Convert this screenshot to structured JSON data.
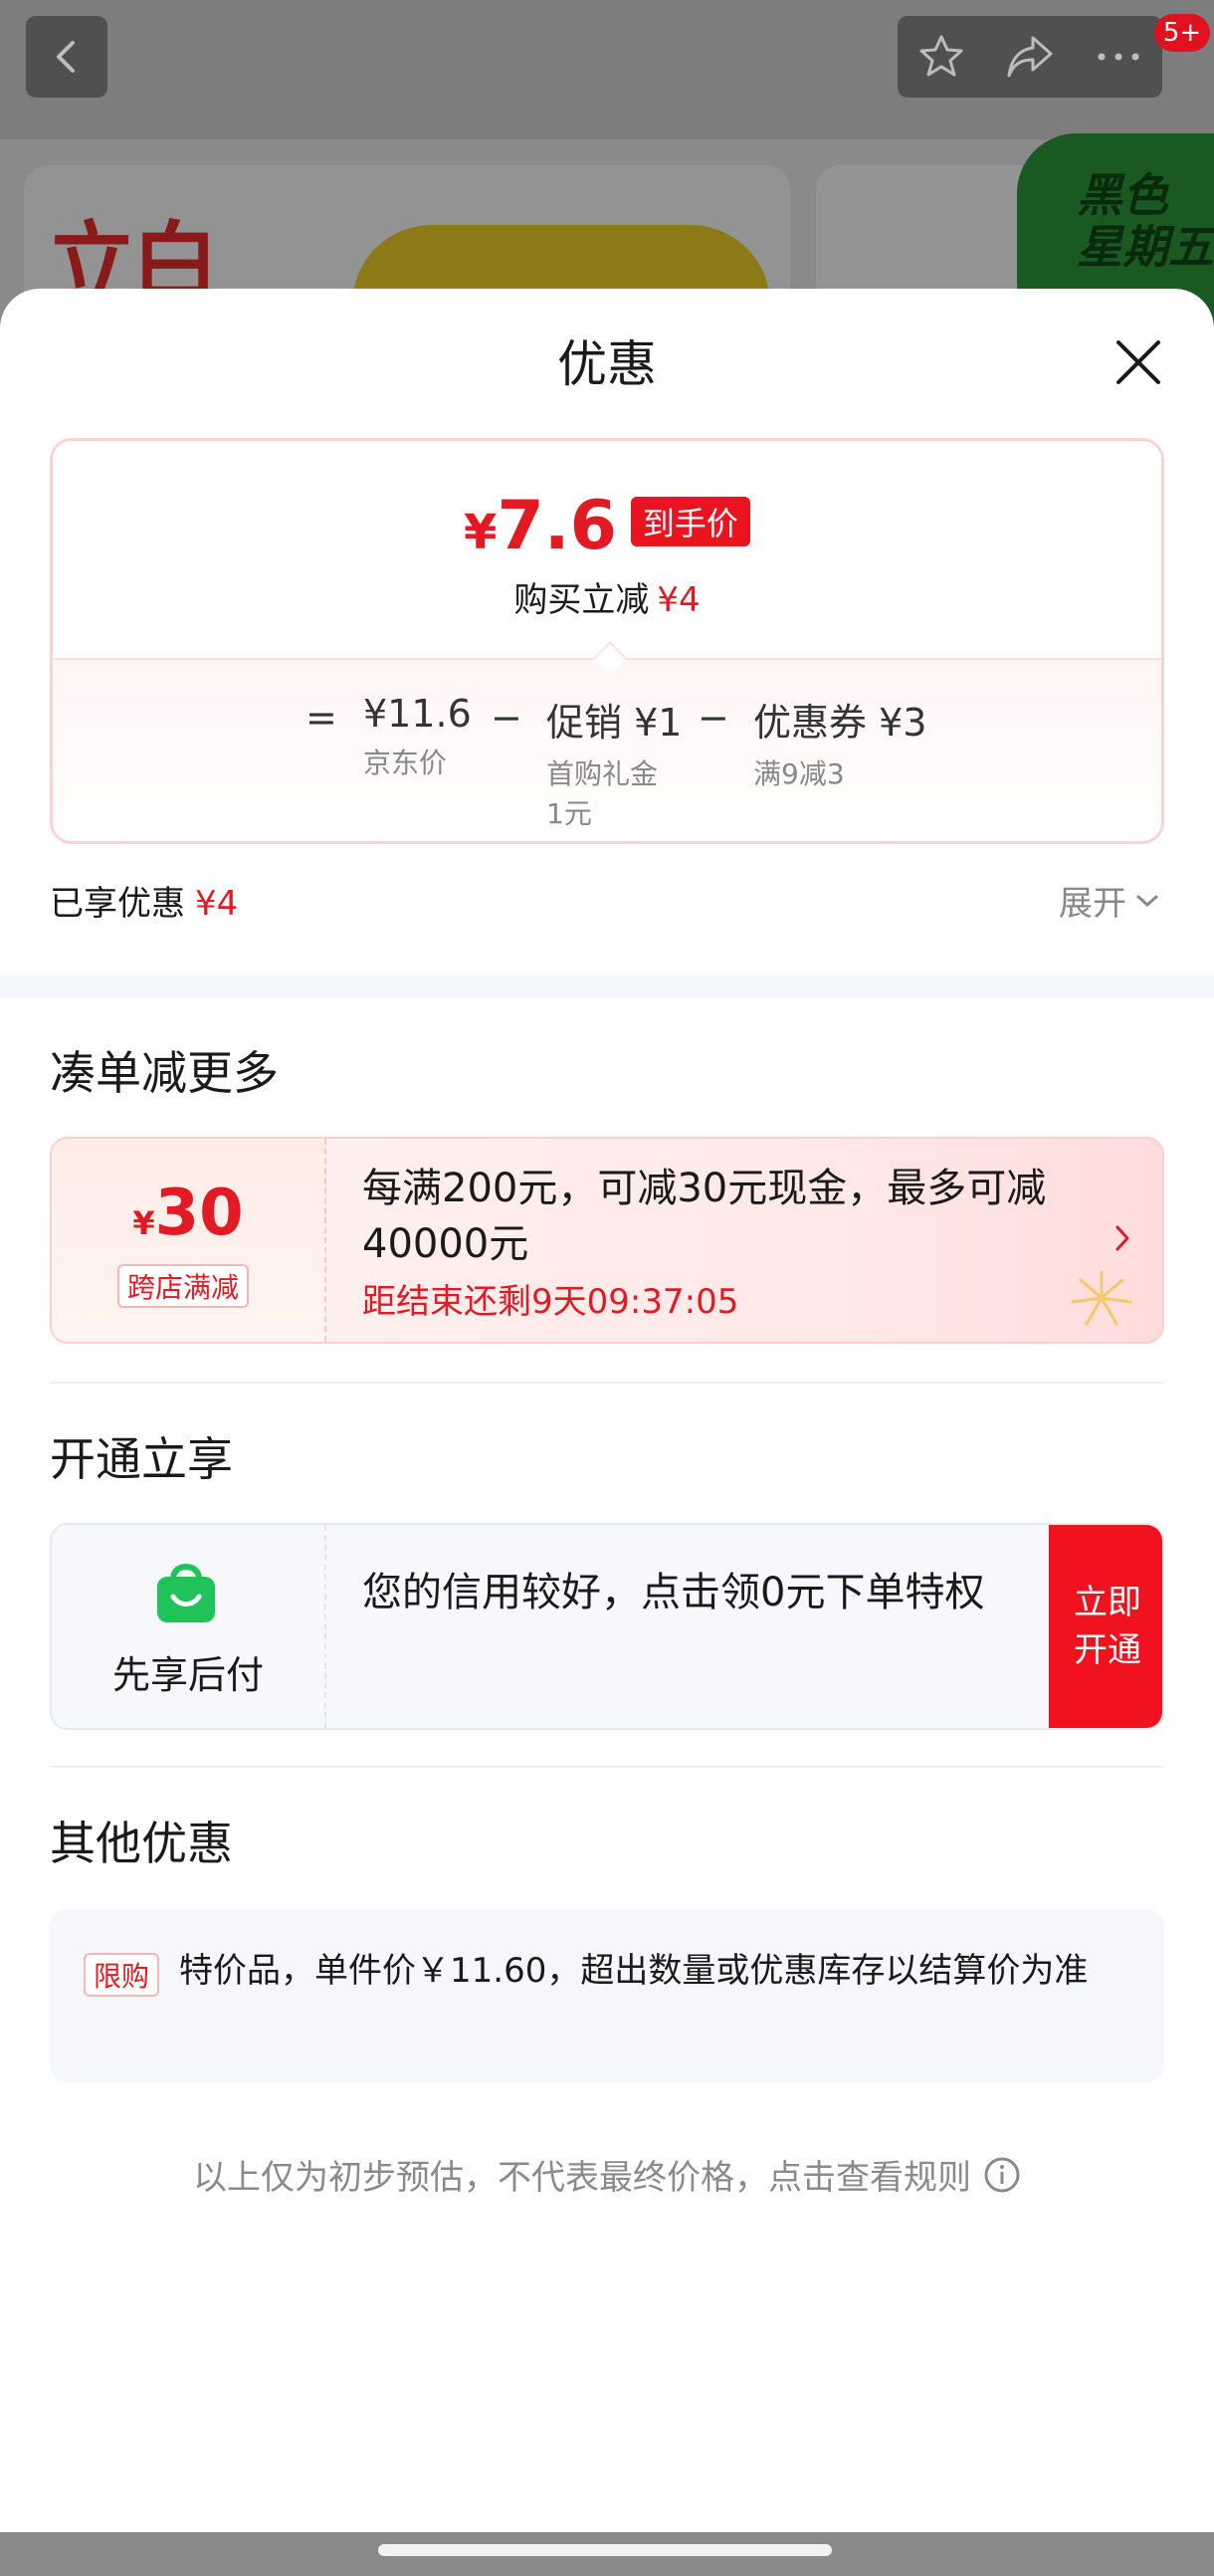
{
  "background": {
    "badge_count": "5+",
    "brand_logo": "立白",
    "promo_badge": "黑色\n星期五"
  },
  "sheet": {
    "title": "优惠",
    "price_card": {
      "currency": "¥",
      "final_price": "7.6",
      "final_tag": "到手价",
      "reduce_label": "购买立减",
      "reduce_value": "¥4",
      "equals": "=",
      "items": [
        {
          "main": "¥11.6",
          "sub": "京东价"
        },
        {
          "main": "促销 ¥1",
          "sub": "首购礼金\n1元"
        },
        {
          "main": "优惠券 ¥3",
          "sub": "满9减3"
        }
      ],
      "minus": "−"
    },
    "enjoyed": {
      "label": "已享优惠",
      "value": "¥4"
    },
    "expand_label": "展开",
    "section_combine": {
      "title": "凑单减更多",
      "coupon": {
        "currency": "¥",
        "amount": "30",
        "tag": "跨店满减",
        "text": "每满200元，可减30元现金，最多可减40000元",
        "timer": "距结束还剩9天09:37:05"
      }
    },
    "section_open": {
      "title": "开通立享",
      "pay": {
        "label": "先享后付",
        "text": "您的信用较好，点击领0元下单特权",
        "button": "立即开通"
      }
    },
    "section_other": {
      "title": "其他优惠",
      "tag": "限购",
      "text": "特价品，单件价￥11.60，超出数量或优惠库存以结算价为准"
    },
    "footnote": "以上仅为初步预估，不代表最终价格，点击查看规则"
  },
  "colors": {
    "accent_red": "#e11a24",
    "button_red": "#f0121f",
    "pay_green": "#22c25a"
  }
}
